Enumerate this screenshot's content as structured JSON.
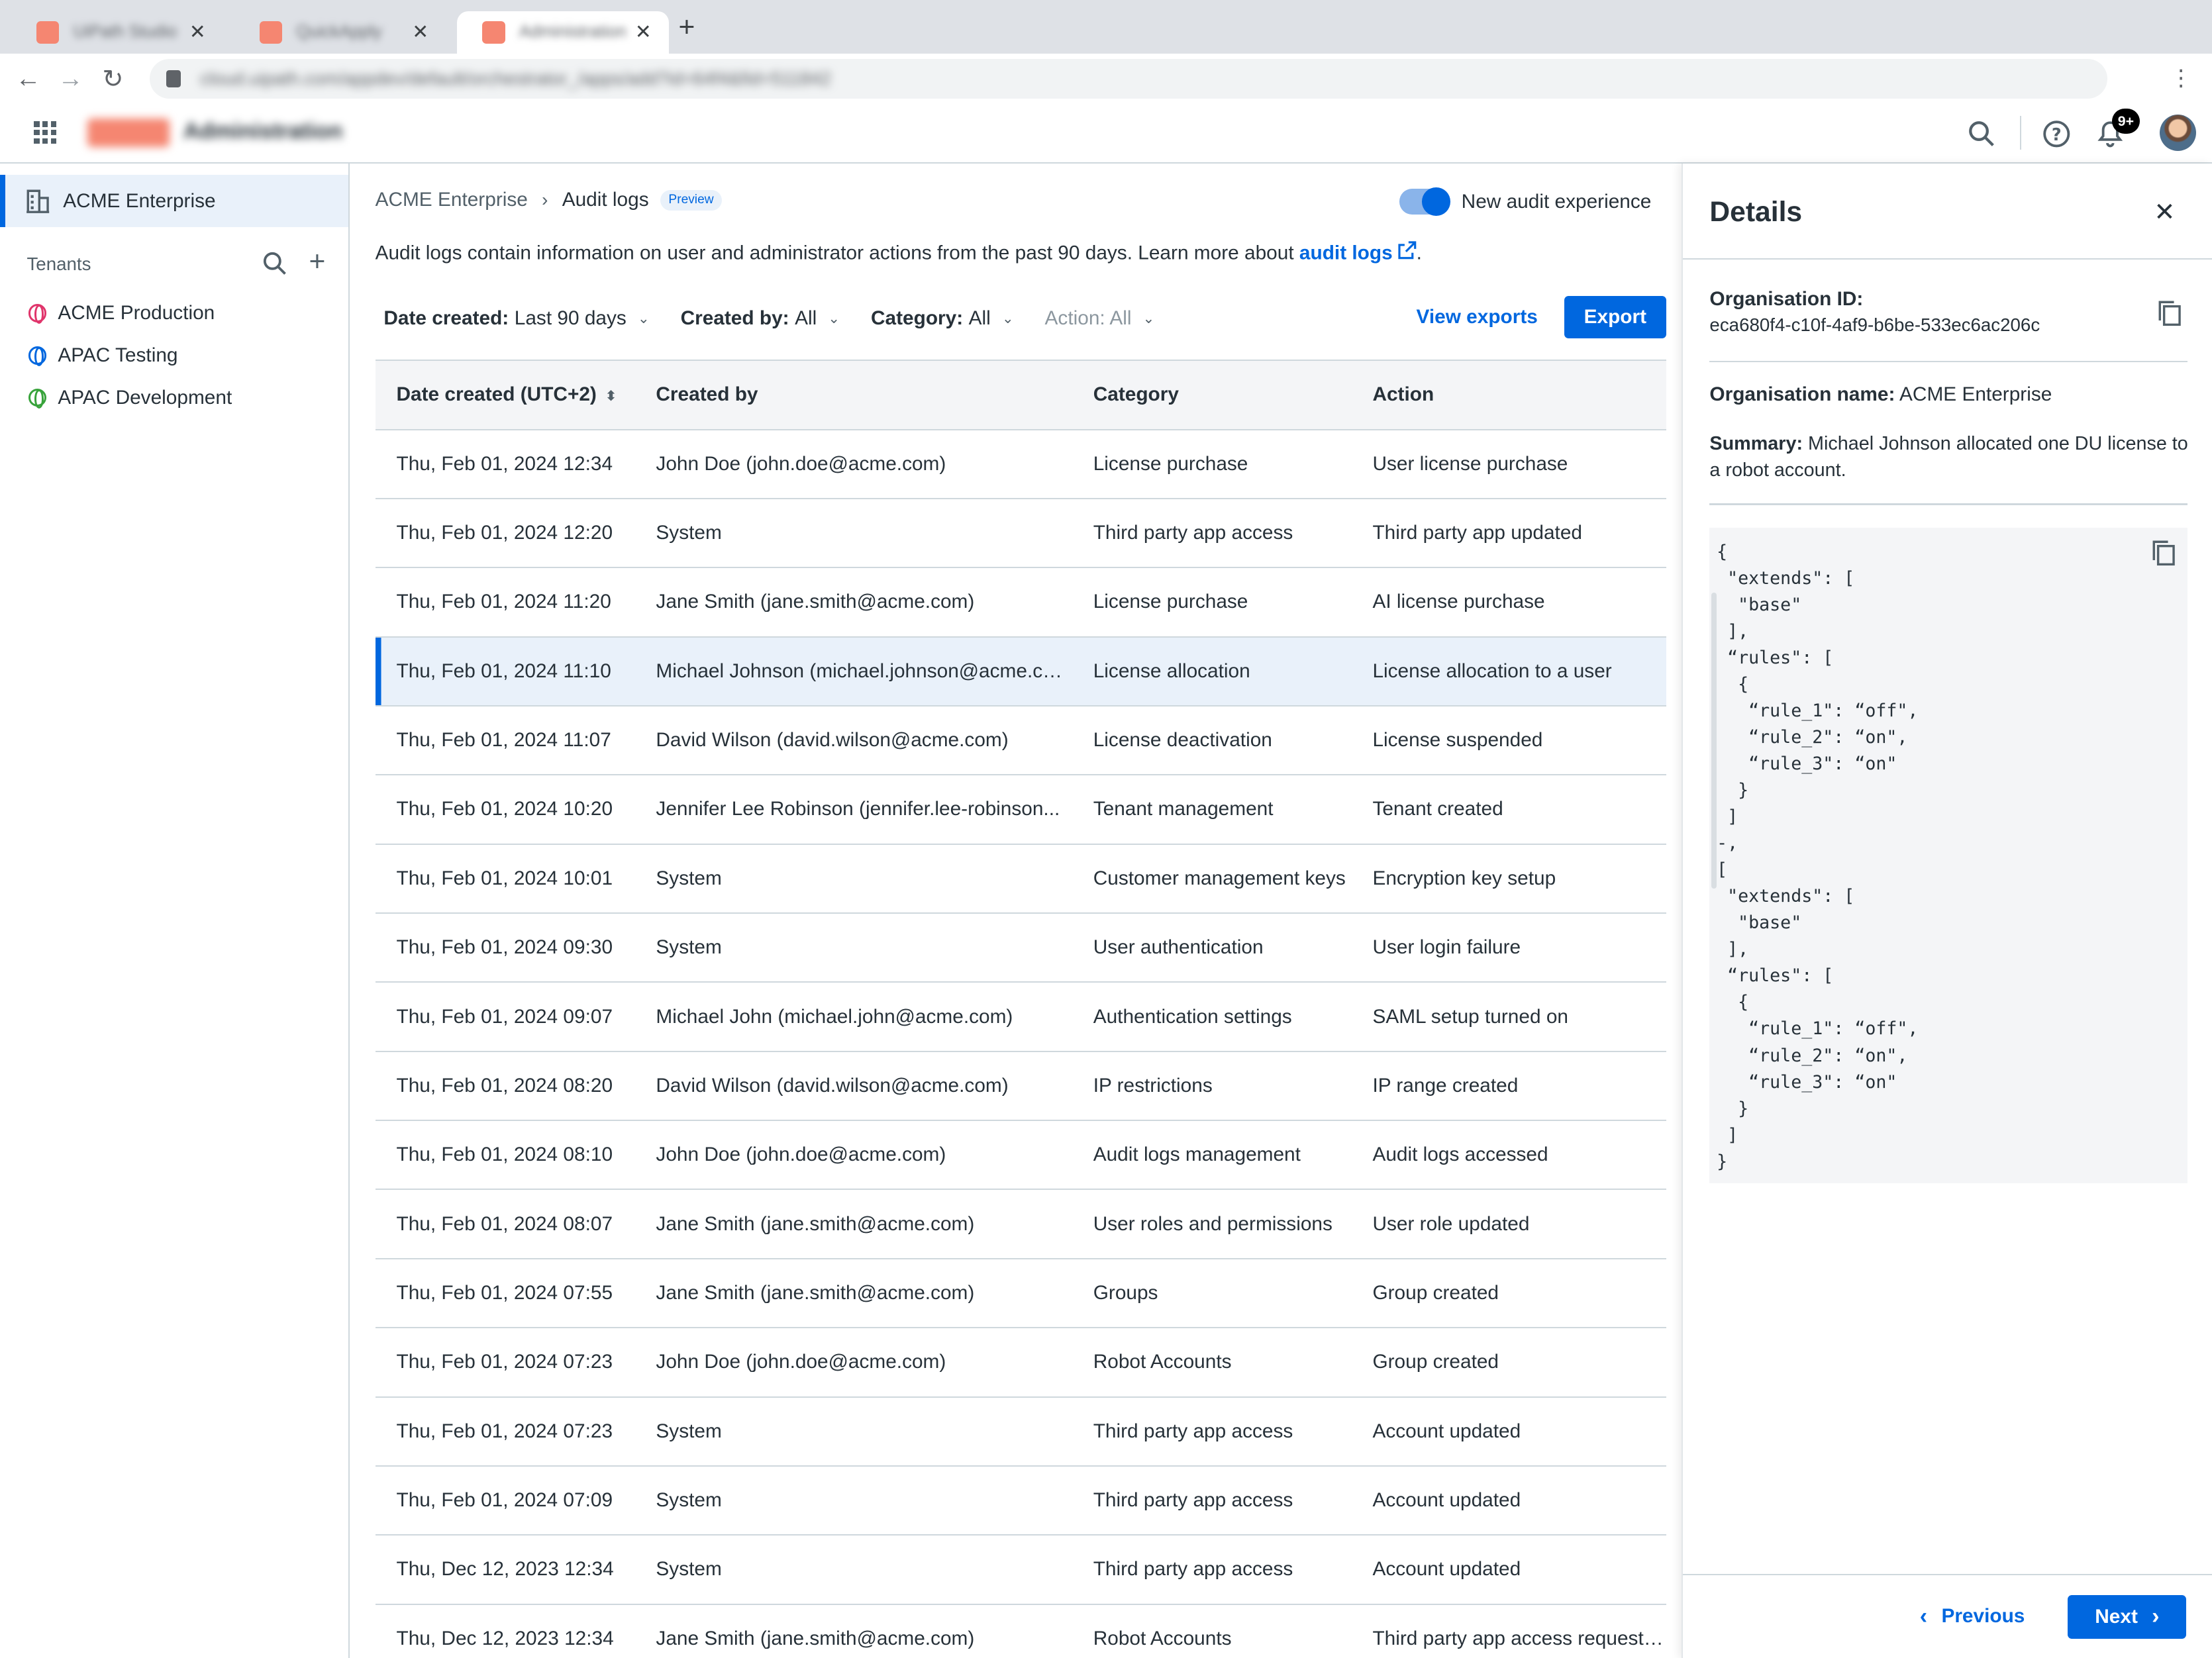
{
  "browser": {
    "tabs": [
      {
        "label": "UiPath Studio"
      },
      {
        "label": "QuickApply"
      },
      {
        "label": "Administration"
      }
    ],
    "url": "cloud.uipath.com/appdev/default/orchestrator_/apps/add?id=64f4&fid=511842"
  },
  "header": {
    "app_name": "Administration",
    "notification_count": "9+"
  },
  "sidebar": {
    "organization": "ACME Enterprise",
    "tenants_label": "Tenants",
    "tenants": [
      {
        "name": "ACME Production",
        "color": "#e0356b"
      },
      {
        "name": "APAC Testing",
        "color": "#0067df"
      },
      {
        "name": "APAC Development",
        "color": "#38a33b"
      }
    ]
  },
  "main": {
    "breadcrumb": {
      "parent": "ACME Enterprise",
      "current": "Audit logs",
      "badge": "Preview"
    },
    "toggle_label": "New audit experience",
    "description": "Audit logs contain information on user and administrator actions from the past 90 days. Learn more about ",
    "description_link": "audit logs",
    "description_end": ".",
    "filters": [
      {
        "label": "Date created:",
        "value": "Last 90 days"
      },
      {
        "label": "Created by:",
        "value": "All"
      },
      {
        "label": "Category:",
        "value": "All"
      },
      {
        "label": "Action: All"
      }
    ],
    "view_exports": "View exports",
    "export": "Export",
    "columns": [
      "Date created (UTC+2)",
      "Created by",
      "Category",
      "Action"
    ],
    "rows": [
      [
        "Thu, Feb 01, 2024 12:34",
        "John Doe (john.doe@acme.com)",
        "License purchase",
        "User license purchase"
      ],
      [
        "Thu, Feb 01, 2024 12:20",
        "System",
        "Third party app access",
        "Third party app updated"
      ],
      [
        "Thu, Feb 01, 2024 11:20",
        "Jane Smith (jane.smith@acme.com)",
        "License purchase",
        "AI license purchase"
      ],
      [
        "Thu, Feb 01, 2024 11:10",
        "Michael Johnson (michael.johnson@acme.com)",
        "License allocation",
        "License allocation to a user"
      ],
      [
        "Thu, Feb 01, 2024 11:07",
        "David Wilson (david.wilson@acme.com)",
        "License deactivation",
        "License suspended"
      ],
      [
        "Thu, Feb 01, 2024 10:20",
        "Jennifer Lee Robinson (jennifer.lee-robinson...",
        "Tenant management",
        "Tenant created"
      ],
      [
        "Thu, Feb 01, 2024 10:01",
        "System",
        "Customer management keys",
        "Encryption key setup"
      ],
      [
        "Thu, Feb 01, 2024 09:30",
        "System",
        "User authentication",
        "User login failure"
      ],
      [
        "Thu, Feb 01, 2024 09:07",
        "Michael John (michael.john@acme.com)",
        "Authentication settings",
        "SAML setup turned on"
      ],
      [
        "Thu, Feb 01, 2024 08:20",
        "David Wilson (david.wilson@acme.com)",
        "IP restrictions",
        "IP range created"
      ],
      [
        "Thu, Feb 01, 2024 08:10",
        "John Doe (john.doe@acme.com)",
        "Audit logs management",
        "Audit logs accessed"
      ],
      [
        "Thu, Feb 01, 2024 08:07",
        "Jane Smith (jane.smith@acme.com)",
        "User roles and permissions",
        "User role updated"
      ],
      [
        "Thu, Feb 01, 2024 07:55",
        "Jane Smith (jane.smith@acme.com)",
        "Groups",
        "Group created"
      ],
      [
        "Thu, Feb 01, 2024 07:23",
        "John Doe (john.doe@acme.com)",
        "Robot Accounts",
        "Group created"
      ],
      [
        "Thu, Feb 01, 2024 07:23",
        "System",
        "Third party app access",
        "Account updated"
      ],
      [
        "Thu, Feb 01, 2024 07:09",
        "System",
        "Third party app access",
        "Account updated"
      ],
      [
        "Thu, Dec 12, 2023 12:34",
        "System",
        "Third party app access",
        "Account updated"
      ],
      [
        "Thu, Dec 12, 2023 12:34",
        "Jane Smith (jane.smith@acme.com)",
        "Robot Accounts",
        "Third party app access request submitted"
      ]
    ],
    "selected_row": 3
  },
  "details": {
    "title": "Details",
    "org_id_label": "Organisation ID:",
    "org_id": "eca680f4-c10f-4af9-b6be-533ec6ac206c",
    "org_name_label": "Organisation name:",
    "org_name": "ACME Enterprise",
    "summary_label": "Summary:",
    "summary": "Michael Johnson allocated one DU license to a robot account.",
    "code": "{\n \"extends\": [\n  \"base\"\n ],\n “rules\": [\n  {\n   “rule_1\": “off\",\n   “rule_2\": “on\",\n   “rule_3\": “on\"\n  }\n ]\n-,\n[\n \"extends\": [\n  \"base\"\n ],\n “rules\": [\n  {\n   “rule_1\": “off\",\n   “rule_2\": “on\",\n   “rule_3\": “on\"\n  }\n ]\n}",
    "previous": "Previous",
    "next": "Next"
  }
}
